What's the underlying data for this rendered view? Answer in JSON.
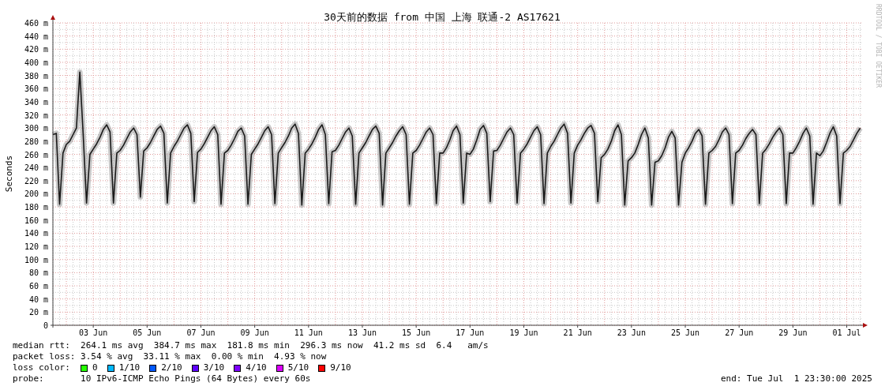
{
  "chart": {
    "side_label": "RRDTOOL / TOBI OETIKER",
    "chart_data": {
      "type": "line",
      "title": "30天前的数据 from 中国 上海 联通-2 AS17621",
      "ylabel": "Seconds",
      "categories": [
        null,
        null,
        null,
        null,
        null,
        null,
        null,
        null,
        null,
        null,
        null,
        null,
        "03 Jun",
        null,
        null,
        null,
        null,
        null,
        null,
        null,
        null,
        null,
        null,
        null,
        null,
        null,
        null,
        null,
        "05 Jun",
        null,
        null,
        null,
        null,
        null,
        null,
        null,
        null,
        null,
        null,
        null,
        null,
        null,
        null,
        null,
        "07 Jun",
        null,
        null,
        null,
        null,
        null,
        null,
        null,
        null,
        null,
        null,
        null,
        null,
        null,
        null,
        null,
        "09 Jun",
        null,
        null,
        null,
        null,
        null,
        null,
        null,
        null,
        null,
        null,
        null,
        null,
        null,
        null,
        null,
        "11 Jun",
        null,
        null,
        null,
        null,
        null,
        null,
        null,
        null,
        null,
        null,
        null,
        null,
        null,
        null,
        null,
        "13 Jun",
        null,
        null,
        null,
        null,
        null,
        null,
        null,
        null,
        null,
        null,
        null,
        null,
        null,
        null,
        null,
        "15 Jun",
        null,
        null,
        null,
        null,
        null,
        null,
        null,
        null,
        null,
        null,
        null,
        null,
        null,
        null,
        null,
        "17 Jun",
        null,
        null,
        null,
        null,
        null,
        null,
        null,
        null,
        null,
        null,
        null,
        null,
        null,
        null,
        null,
        "19 Jun",
        null,
        null,
        null,
        null,
        null,
        null,
        null,
        null,
        null,
        null,
        null,
        null,
        null,
        null,
        null,
        "21 Jun",
        null,
        null,
        null,
        null,
        null,
        null,
        null,
        null,
        null,
        null,
        null,
        null,
        null,
        null,
        null,
        "23 Jun",
        null,
        null,
        null,
        null,
        null,
        null,
        null,
        null,
        null,
        null,
        null,
        null,
        null,
        null,
        null,
        "25 Jun",
        null,
        null,
        null,
        null,
        null,
        null,
        null,
        null,
        null,
        null,
        null,
        null,
        null,
        null,
        null,
        "27 Jun",
        null,
        null,
        null,
        null,
        null,
        null,
        null,
        null,
        null,
        null,
        null,
        null,
        null,
        null,
        null,
        "29 Jun",
        null,
        null,
        null,
        null,
        null,
        null,
        null,
        null,
        null,
        null,
        null,
        null,
        null,
        null,
        null,
        "01 Jul",
        null,
        null,
        null,
        null
      ],
      "series": [
        {
          "color": "#1a1a1a",
          "values": [
            290,
            292,
            184,
            262,
            275,
            280,
            290,
            300,
            385,
            292,
            186,
            260,
            268,
            276,
            286,
            298,
            305,
            294,
            186,
            262,
            266,
            274,
            284,
            294,
            300,
            290,
            195,
            265,
            270,
            278,
            288,
            298,
            303,
            292,
            186,
            262,
            272,
            280,
            290,
            300,
            305,
            292,
            188,
            263,
            268,
            276,
            286,
            296,
            302,
            290,
            184,
            262,
            266,
            274,
            284,
            295,
            300,
            288,
            184,
            260,
            268,
            276,
            286,
            296,
            302,
            290,
            185,
            262,
            270,
            278,
            288,
            300,
            306,
            292,
            183,
            262,
            268,
            276,
            286,
            298,
            305,
            290,
            185,
            264,
            266,
            274,
            284,
            294,
            300,
            288,
            184,
            262,
            270,
            278,
            288,
            298,
            303,
            292,
            183,
            262,
            270,
            278,
            288,
            296,
            302,
            290,
            184,
            262,
            266,
            274,
            284,
            294,
            300,
            290,
            185,
            262,
            262,
            270,
            282,
            296,
            303,
            290,
            186,
            262,
            260,
            268,
            282,
            298,
            304,
            292,
            188,
            265,
            266,
            274,
            284,
            294,
            300,
            290,
            186,
            262,
            268,
            276,
            286,
            296,
            302,
            290,
            185,
            262,
            272,
            280,
            290,
            300,
            306,
            292,
            186,
            262,
            274,
            282,
            292,
            300,
            304,
            292,
            188,
            255,
            260,
            268,
            280,
            296,
            305,
            290,
            183,
            250,
            255,
            262,
            275,
            290,
            300,
            285,
            183,
            248,
            250,
            258,
            270,
            286,
            295,
            285,
            183,
            248,
            262,
            270,
            280,
            292,
            298,
            288,
            184,
            262,
            266,
            272,
            282,
            294,
            300,
            290,
            185,
            262,
            266,
            274,
            284,
            292,
            298,
            290,
            185,
            262,
            268,
            276,
            286,
            294,
            300,
            290,
            185,
            262,
            262,
            270,
            280,
            292,
            300,
            288,
            184,
            262,
            258,
            265,
            278,
            292,
            302,
            288,
            185,
            262,
            266,
            272,
            282,
            292,
            300
          ]
        }
      ],
      "ylim": [
        0,
        460
      ],
      "grid": true,
      "yticks": [
        {
          "value": 0,
          "label": "0"
        },
        {
          "value": 20,
          "label": "20 m"
        },
        {
          "value": 40,
          "label": "40 m"
        },
        {
          "value": 60,
          "label": "60 m"
        },
        {
          "value": 80,
          "label": "80 m"
        },
        {
          "value": 100,
          "label": "100 m"
        },
        {
          "value": 120,
          "label": "120 m"
        },
        {
          "value": 140,
          "label": "140 m"
        },
        {
          "value": 160,
          "label": "160 m"
        },
        {
          "value": 180,
          "label": "180 m"
        },
        {
          "value": 200,
          "label": "200 m"
        },
        {
          "value": 220,
          "label": "220 m"
        },
        {
          "value": 240,
          "label": "240 m"
        },
        {
          "value": 260,
          "label": "260 m"
        },
        {
          "value": 280,
          "label": "280 m"
        },
        {
          "value": 300,
          "label": "300 m"
        },
        {
          "value": 320,
          "label": "320 m"
        },
        {
          "value": 340,
          "label": "340 m"
        },
        {
          "value": 360,
          "label": "360 m"
        },
        {
          "value": 380,
          "label": "380 m"
        },
        {
          "value": 400,
          "label": "400 m"
        },
        {
          "value": 420,
          "label": "420 m"
        },
        {
          "value": 440,
          "label": "440 m"
        },
        {
          "value": 460,
          "label": "460 m"
        }
      ]
    }
  },
  "legend": {
    "median_rtt": {
      "label": "median rtt:",
      "text": "264.1 ms avg  384.7 ms max  181.8 ms min  296.3 ms now  41.2 ms sd  6.4   am/s"
    },
    "packet_loss": {
      "label": "packet loss:",
      "text": "3.54 % avg  33.11 % max  0.00 % min  4.93 % now"
    },
    "loss_color": {
      "label": "loss color:",
      "items": [
        {
          "label": "0",
          "color": "#26ff00"
        },
        {
          "label": "1/10",
          "color": "#00b8ff"
        },
        {
          "label": "2/10",
          "color": "#0059ff"
        },
        {
          "label": "3/10",
          "color": "#5e00ff"
        },
        {
          "label": "4/10",
          "color": "#7e00ff"
        },
        {
          "label": "5/10",
          "color": "#dd00ff"
        },
        {
          "label": "9/10",
          "color": "#ff0000"
        }
      ]
    },
    "probe": {
      "label": "probe:",
      "text": "10 IPv6-ICMP Echo Pings (64 Bytes) every 60s"
    },
    "end": "end: Tue Jul  1 23:30:00 2025"
  }
}
